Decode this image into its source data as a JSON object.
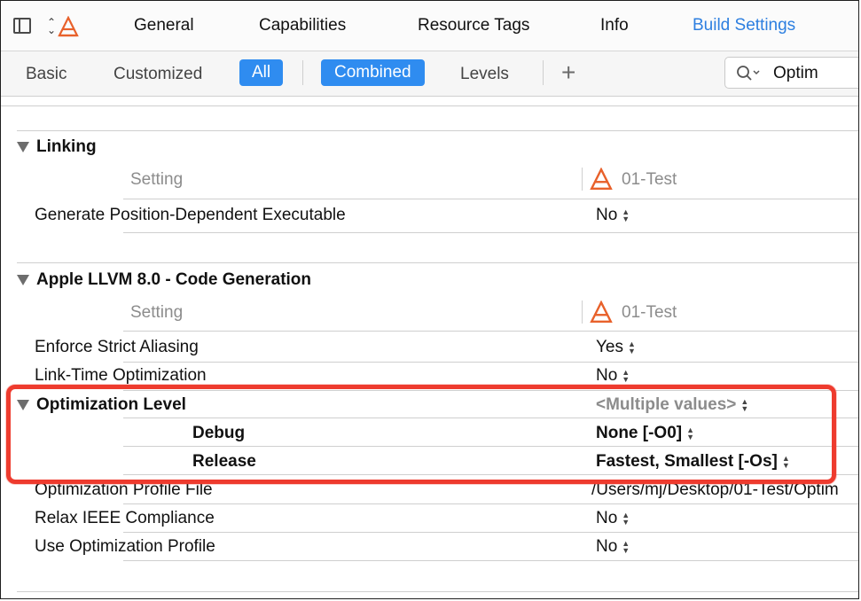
{
  "tabs": {
    "general": "General",
    "capabilities": "Capabilities",
    "resource_tags": "Resource Tags",
    "info": "Info",
    "build_settings": "Build Settings"
  },
  "filter": {
    "basic": "Basic",
    "customized": "Customized",
    "all": "All",
    "combined": "Combined",
    "levels": "Levels",
    "add": "+",
    "search_value": "Optim"
  },
  "target_name": "01-Test",
  "column_setting": "Setting",
  "sections": {
    "linking": {
      "title": "Linking",
      "rows": [
        {
          "label": "Generate Position-Dependent Executable",
          "value": "No"
        }
      ]
    },
    "codegen": {
      "title": "Apple LLVM 8.0 - Code Generation",
      "rows": [
        {
          "label": "Enforce Strict Aliasing",
          "value": "Yes"
        },
        {
          "label": "Link-Time Optimization",
          "value": "No"
        }
      ],
      "optimization": {
        "label": "Optimization Level",
        "value": "<Multiple values>",
        "debug_label": "Debug",
        "debug_value": "None [-O0]",
        "release_label": "Release",
        "release_value": "Fastest, Smallest [-Os]"
      },
      "rows_after": [
        {
          "label": "Optimization Profile File",
          "value": "/Users/mj/Desktop/01-Test/Optim"
        },
        {
          "label": "Relax IEEE Compliance",
          "value": "No"
        },
        {
          "label": "Use Optimization Profile",
          "value": "No"
        }
      ]
    }
  },
  "colors": {
    "accent": "#2f8cf0",
    "highlight": "#ee3b2e"
  }
}
